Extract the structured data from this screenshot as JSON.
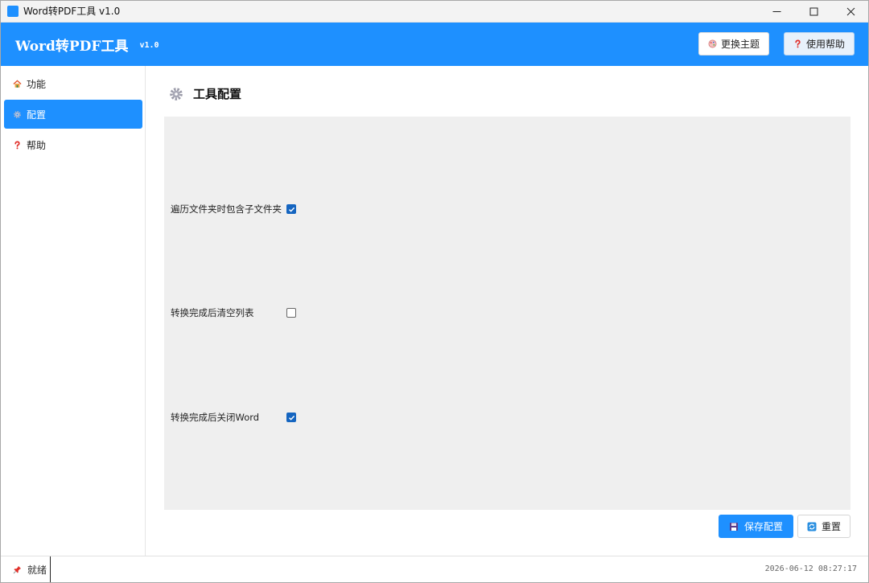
{
  "window": {
    "title": "Word转PDF工具 v1.0"
  },
  "header": {
    "title": "Word转PDF工具",
    "version": "v1.0",
    "theme_button": "更换主题",
    "help_button": "使用帮助"
  },
  "sidebar": {
    "items": [
      {
        "label": "功能",
        "icon": "home-icon",
        "active": false
      },
      {
        "label": "配置",
        "icon": "gear-icon",
        "active": true
      },
      {
        "label": "帮助",
        "icon": "question-icon",
        "active": false
      }
    ]
  },
  "main": {
    "title": "工具配置",
    "options": [
      {
        "label": "遍历文件夹时包含子文件夹",
        "checked": true
      },
      {
        "label": "转换完成后清空列表",
        "checked": false
      },
      {
        "label": "转换完成后关闭Word",
        "checked": true
      }
    ],
    "save_button": "保存配置",
    "reset_button": "重置"
  },
  "status": {
    "text": "就绪",
    "timestamp": "2026-06-12 08:27:17"
  },
  "colors": {
    "accent": "#1e90ff",
    "checkbox": "#1565c0",
    "panel": "#efefef"
  }
}
